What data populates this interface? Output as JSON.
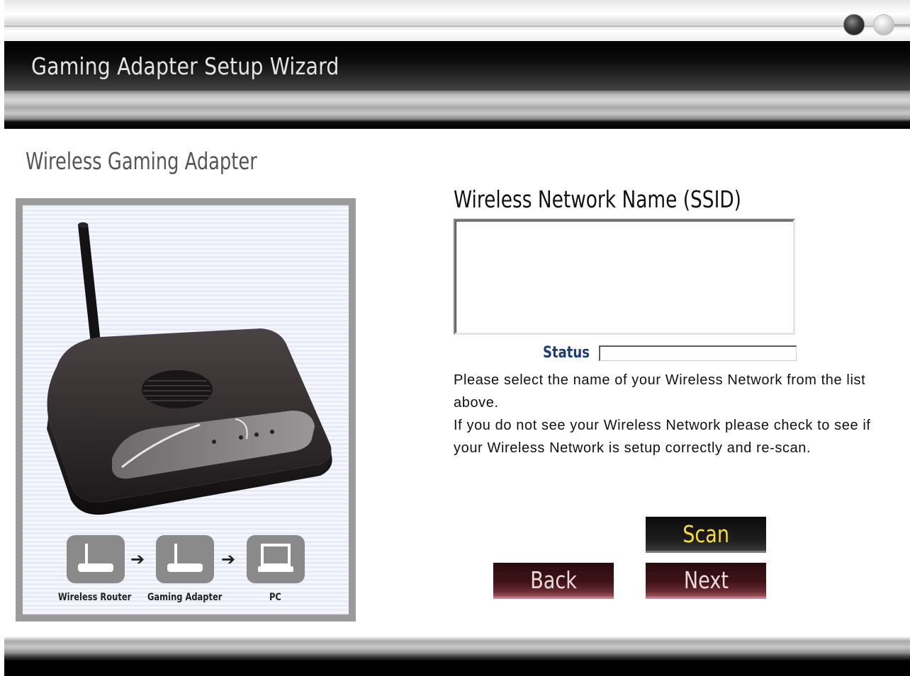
{
  "window": {
    "title": "Gaming Adapter Setup Wizard"
  },
  "left_panel": {
    "heading": "Wireless Gaming Adapter",
    "diagram_labels": [
      "Wireless Router",
      "Gaming Adapter",
      "PC"
    ]
  },
  "form": {
    "ssid_label": "Wireless Network Name (SSID)",
    "ssid_items": [],
    "status_label": "Status",
    "status_value": "",
    "instructions": [
      "Please select the name of your Wireless Network from the list above.",
      "If you do not see your Wireless Network please check to see if your Wireless Network is setup correctly and re-scan."
    ]
  },
  "buttons": {
    "scan": "Scan",
    "back": "Back",
    "next": "Next"
  },
  "colors": {
    "scan_text": "#f5dc3a",
    "status_label": "#1b3c78",
    "nav_button": "#3e1318"
  }
}
